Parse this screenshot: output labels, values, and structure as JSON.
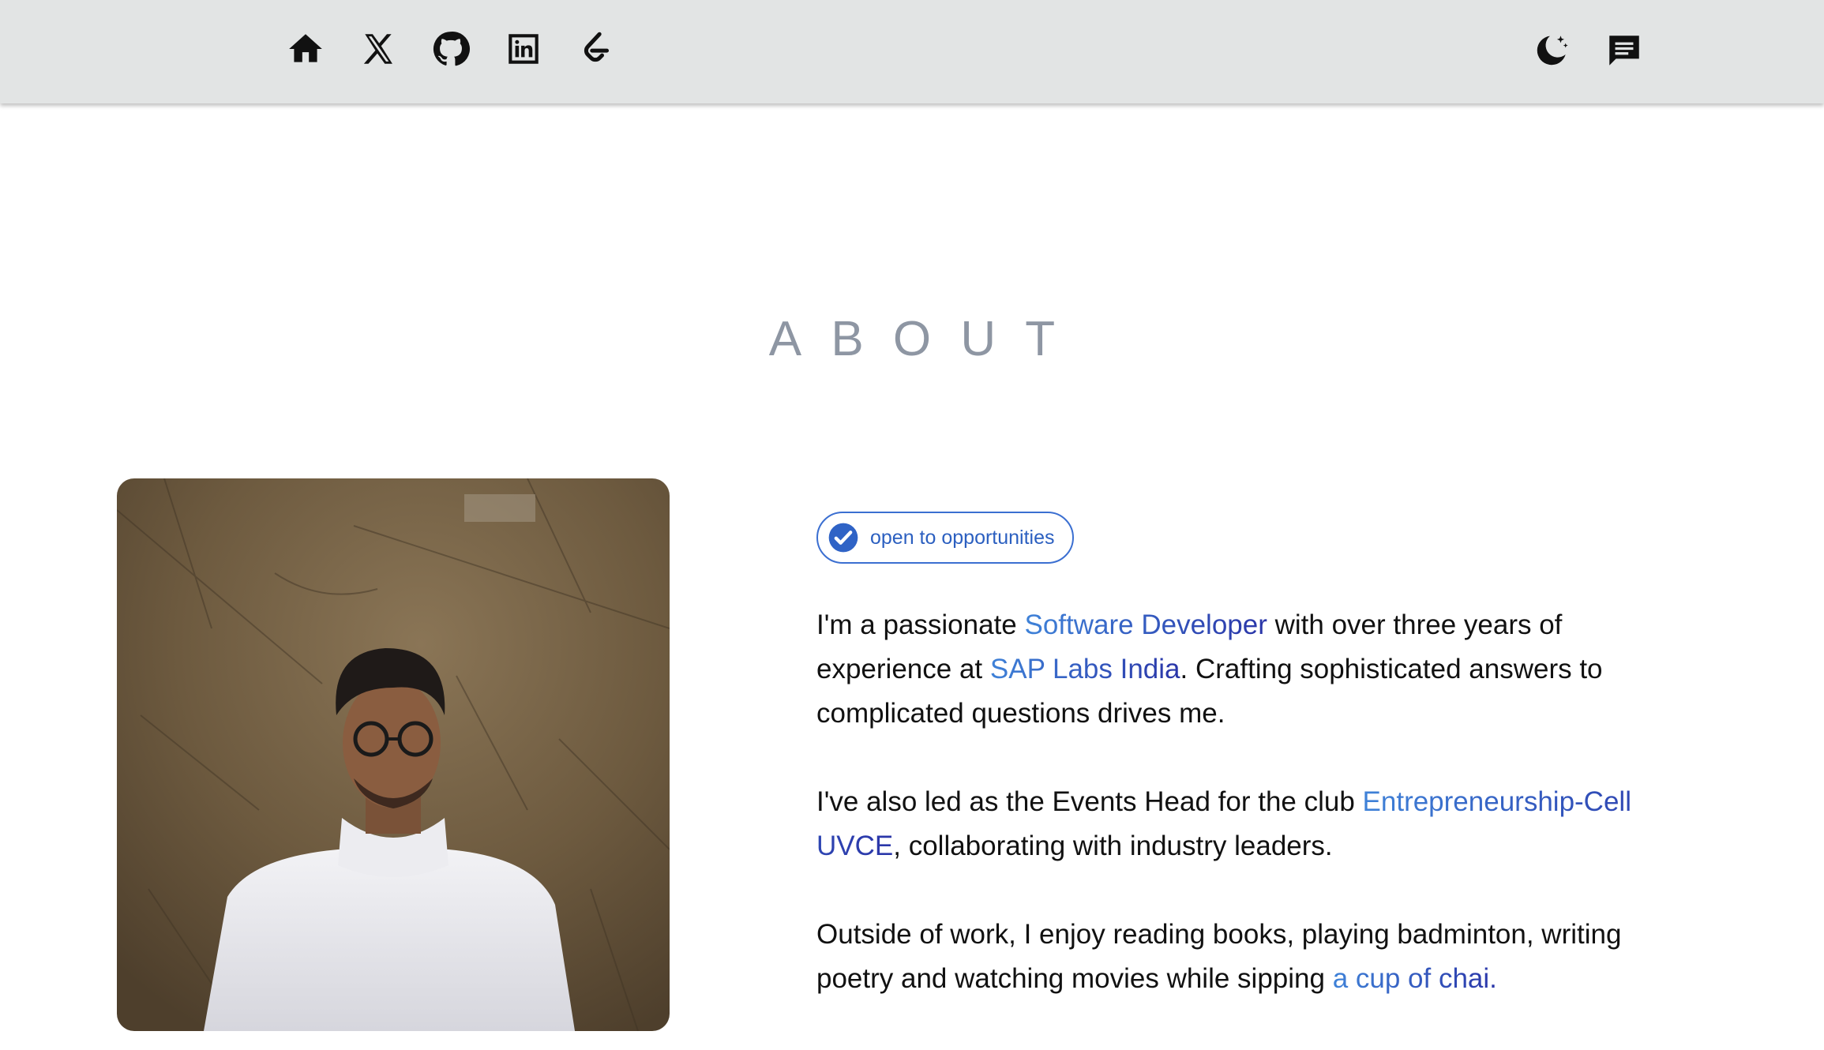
{
  "nav": {
    "left_icons": [
      "home-icon",
      "x-twitter-icon",
      "github-icon",
      "linkedin-icon",
      "leetcode-icon"
    ],
    "right_icons": [
      "dark-mode-moon-icon",
      "message-icon"
    ]
  },
  "colors": {
    "topbar_bg": "#e2e4e4",
    "heading": "#8e96a3",
    "link_start": "#3f82d8",
    "link_end": "#2a35a8",
    "badge": "#2b5fc0"
  },
  "about": {
    "heading": "ABOUT",
    "badge_label": "open to opportunities",
    "p1": {
      "t1": "I'm a passionate ",
      "l1": "Software Developer",
      "t2": " with over three years of experience at ",
      "l2": "SAP Labs India",
      "t3": ". Crafting sophisticated answers to complicated questions drives me."
    },
    "p2": {
      "t1": "I've also led as the Events Head for the club ",
      "l1": "Entrepreneurship-Cell UVCE",
      "t2": ", collaborating with industry leaders."
    },
    "p3": {
      "t1": "Outside of work, I enjoy reading books, playing badminton, writing poetry and watching movies while sipping ",
      "l1": "a cup of chai."
    }
  }
}
